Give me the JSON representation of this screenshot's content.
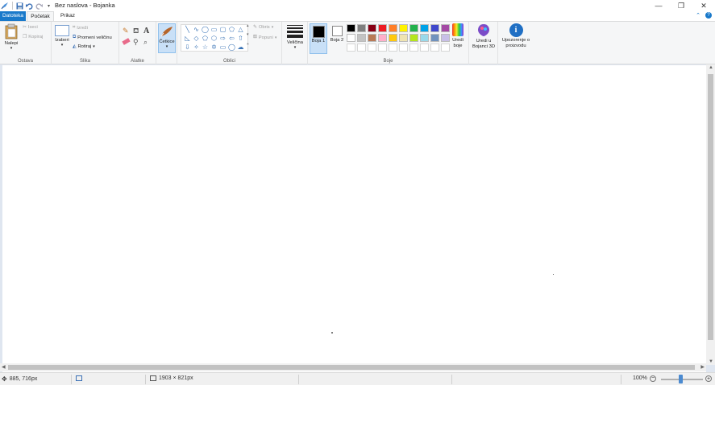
{
  "window": {
    "title": "Bez naslova - Bojanka",
    "controls": {
      "minimize": "—",
      "maximize": "❐",
      "close": "✕"
    }
  },
  "menu": {
    "file": "Datoteka",
    "home": "Početak",
    "view": "Prikaz",
    "collapse_icon": "chevron-up-icon",
    "help_icon": "help-icon"
  },
  "ribbon": {
    "clipboard": {
      "label": "Ostava",
      "paste": "Nalepi",
      "cut": "Iseci",
      "copy": "Kopiraj"
    },
    "image": {
      "label": "Slika",
      "select": "Izaberi",
      "crop": "Izreži",
      "resize": "Promeni veličinu",
      "rotate": "Rotiraj"
    },
    "tools": {
      "label": "Alatke"
    },
    "brushes": {
      "label": "Četkice"
    },
    "shapes": {
      "label": "Oblici",
      "outline": "Obris",
      "fill": "Popuni"
    },
    "size": {
      "label": "Veličina"
    },
    "colors": {
      "label": "Boje",
      "color1": "Boja 1",
      "color2": "Boja 2",
      "edit": "Uredi boje",
      "paint3d": "Uredi u Bojanci 3D",
      "notice": "Upozorenje o proizvodu",
      "color1_value": "#000000",
      "color2_value": "#ffffff",
      "palette": [
        "#000000",
        "#7f7f7f",
        "#880015",
        "#ed1c24",
        "#ff7f27",
        "#fff200",
        "#22b14c",
        "#00a2e8",
        "#3f48cc",
        "#a349a4",
        "#ffffff",
        "#c3c3c3",
        "#b97a57",
        "#ffaec9",
        "#ffc90e",
        "#efe4b0",
        "#b5e61d",
        "#99d9ea",
        "#7092be",
        "#c8bfe7",
        "#ffffff",
        "#ffffff",
        "#ffffff",
        "#ffffff",
        "#ffffff",
        "#ffffff",
        "#ffffff",
        "#ffffff",
        "#ffffff",
        "#ffffff"
      ]
    }
  },
  "status": {
    "cursor_pos": "885, 716px",
    "selection_size": "",
    "canvas_size": "1903 × 821px",
    "file_size": "",
    "zoom": "100%"
  }
}
